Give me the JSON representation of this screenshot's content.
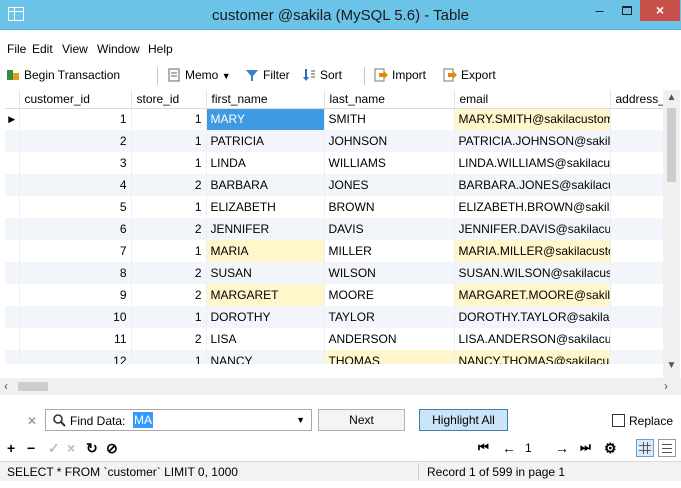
{
  "window": {
    "title": "customer @sakila (MySQL 5.6) - Table",
    "minimize": "–",
    "close": "×"
  },
  "menu": [
    "File",
    "Edit",
    "View",
    "Window",
    "Help"
  ],
  "toolbar": {
    "begin_transaction": "Begin Transaction",
    "memo": "Memo",
    "filter": "Filter",
    "sort": "Sort",
    "import": "Import",
    "export": "Export"
  },
  "grid": {
    "columns": [
      "customer_id",
      "store_id",
      "first_name",
      "last_name",
      "email",
      "address_i"
    ],
    "rows": [
      [
        "1",
        "1",
        "MARY",
        "SMITH",
        "MARY.SMITH@sakilacustom"
      ],
      [
        "2",
        "1",
        "PATRICIA",
        "JOHNSON",
        "PATRICIA.JOHNSON@sakila"
      ],
      [
        "3",
        "1",
        "LINDA",
        "WILLIAMS",
        "LINDA.WILLIAMS@sakilacus"
      ],
      [
        "4",
        "2",
        "BARBARA",
        "JONES",
        "BARBARA.JONES@sakilacust"
      ],
      [
        "5",
        "1",
        "ELIZABETH",
        "BROWN",
        "ELIZABETH.BROWN@sakilac"
      ],
      [
        "6",
        "2",
        "JENNIFER",
        "DAVIS",
        "JENNIFER.DAVIS@sakilacust"
      ],
      [
        "7",
        "1",
        "MARIA",
        "MILLER",
        "MARIA.MILLER@sakilacusto"
      ],
      [
        "8",
        "2",
        "SUSAN",
        "WILSON",
        "SUSAN.WILSON@sakilacust"
      ],
      [
        "9",
        "2",
        "MARGARET",
        "MOORE",
        "MARGARET.MOORE@sakila"
      ],
      [
        "10",
        "1",
        "DOROTHY",
        "TAYLOR",
        "DOROTHY.TAYLOR@sakilac"
      ],
      [
        "11",
        "2",
        "LISA",
        "ANDERSON",
        "LISA.ANDERSON@sakilacust"
      ],
      [
        "12",
        "1",
        "NANCY",
        "THOMAS",
        "NANCY.THOMAS@sakilacu"
      ]
    ],
    "highlights": [
      [
        0,
        2,
        "sel"
      ],
      [
        0,
        4,
        "hl"
      ],
      [
        6,
        2,
        "hl"
      ],
      [
        6,
        4,
        "hl"
      ],
      [
        8,
        2,
        "hl"
      ],
      [
        8,
        4,
        "hl"
      ],
      [
        11,
        3,
        "hl"
      ],
      [
        11,
        4,
        "hl"
      ]
    ],
    "current_row_marker": "▶"
  },
  "find": {
    "label": "Find Data:",
    "value": "MA",
    "next": "Next",
    "highlight_all": "Highlight All",
    "replace": "Replace"
  },
  "nav": {
    "page": "1"
  },
  "status": {
    "sql": "SELECT * FROM `customer` LIMIT 0, 1000",
    "record": "Record 1 of 599 in page 1"
  },
  "colors": {
    "title_bar": "#6cc3e8",
    "close_button": "#c7504b",
    "selection": "#3e9ae2",
    "match_highlight": "#fff6cc"
  }
}
